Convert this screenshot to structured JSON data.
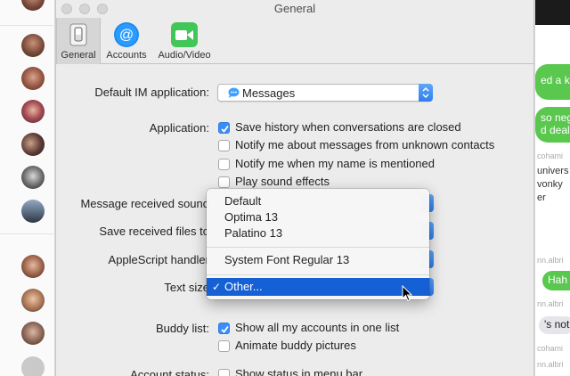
{
  "window": {
    "title": "General"
  },
  "toolbar": {
    "tabs": [
      {
        "label": "General",
        "icon": "switch-icon"
      },
      {
        "label": "Accounts",
        "icon": "at-sign-icon"
      },
      {
        "label": "Audio/Video",
        "icon": "video-camera-icon"
      }
    ]
  },
  "settings": {
    "default_im": {
      "label": "Default IM application:",
      "value": "Messages"
    },
    "application": {
      "label": "Application:",
      "options": [
        {
          "text": "Save history when conversations are closed",
          "checked": true
        },
        {
          "text": "Notify me about messages from unknown contacts",
          "checked": false
        },
        {
          "text": "Notify me when my name is mentioned",
          "checked": false
        },
        {
          "text": "Play sound effects",
          "checked": false
        }
      ]
    },
    "message_sound_label": "Message received sound",
    "save_files_label": "Save received files to",
    "applescript_label": "AppleScript handler",
    "text_size_label": "Text size",
    "buddy_list": {
      "label": "Buddy list:",
      "options": [
        {
          "text": "Show all my accounts in one list",
          "checked": true
        },
        {
          "text": "Animate buddy pictures",
          "checked": false
        }
      ]
    },
    "account_status": {
      "label": "Account status:",
      "option": {
        "text": "Show status in menu bar",
        "checked": false
      }
    }
  },
  "dropdown": {
    "items": [
      "Default",
      "Optima 13",
      "Palatino 13",
      "System Font Regular 13"
    ],
    "selected": "Other..."
  },
  "background": {
    "bubbles": [
      "ed a kid",
      "so neg",
      "d deal",
      "Hah",
      "'s not"
    ],
    "names": [
      "cohami",
      "nn.albri",
      "nn.albri",
      "cohami",
      "nn.albri"
    ],
    "text_lines": [
      "univers",
      "vonky",
      "er"
    ]
  },
  "colors": {
    "accent": "#1560d4",
    "checkbox": "#3b8df7",
    "bubble_green": "#5ac84e"
  }
}
